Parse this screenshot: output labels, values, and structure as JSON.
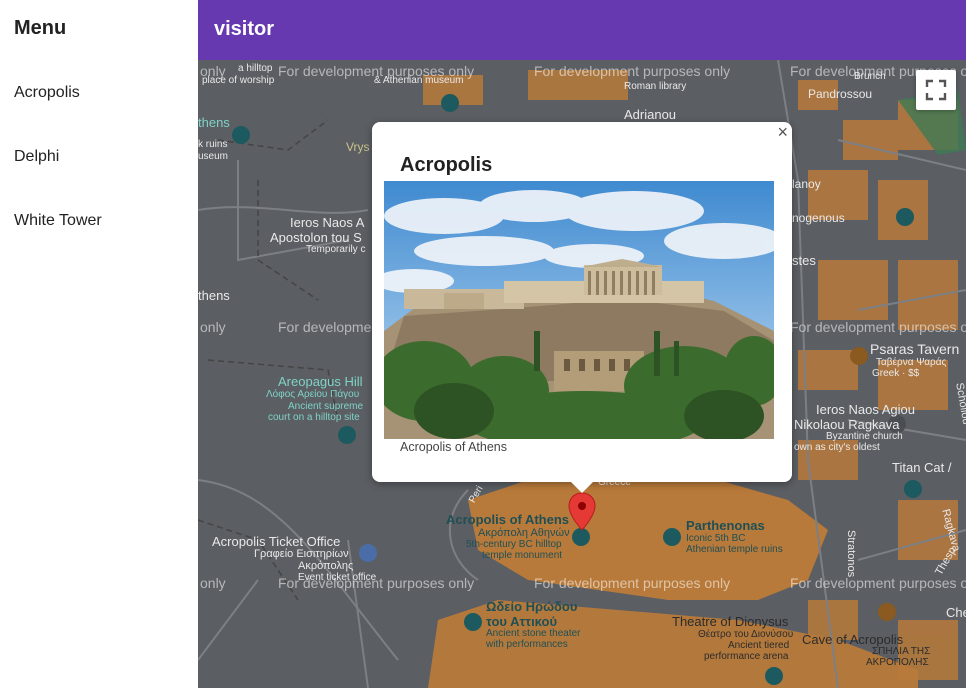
{
  "sidebar": {
    "title": "Menu",
    "items": [
      {
        "label": "Acropolis"
      },
      {
        "label": "Delphi"
      },
      {
        "label": "White Tower"
      }
    ]
  },
  "appbar": {
    "title": "visitor",
    "color": "#6639b0"
  },
  "map": {
    "watermark": "For development purposes only",
    "watermark_short": "only",
    "fullscreen_icon": "fullscreen-icon",
    "labels": {
      "adrianou": "Adrianou",
      "pandrossou": "Pandrossou",
      "roman_library": "Roman library",
      "hilltop_worship": "a hilltop",
      "place_worship": "place of worship",
      "athenian_museum": "& Athenian museum",
      "athens": "thens",
      "ruins": "k ruins",
      "museum": "useum",
      "vrys": "Vrys",
      "ieros_naos": "Ieros Naos A",
      "apostolon": "Apostolon tou S",
      "temp_closed": "Temporarily c",
      "athens2": "thens",
      "areopagus": "Areopagus Hill",
      "areopagus_gr": "Λόφος Αρείου Πάγου",
      "areopagus_desc1": "Ancient supreme",
      "areopagus_desc2": "court on a hilltop site",
      "ticket_office": "Acropolis Ticket Office",
      "ticket_gr1": "Γραφείο Εισιτηρίων",
      "ticket_gr2": "Ακρόπολης",
      "ticket_desc": "Event ticket office",
      "acropolis": "Acropolis of Athens",
      "acropolis_gr": "Ακρόπολη Αθηνών",
      "acropolis_desc1": "5th-century BC hilltop",
      "acropolis_desc2": "temple monument",
      "parthenonas": "Parthenonas",
      "parthenon_desc1": "Iconic 5th BC",
      "parthenon_desc2": "Athenian temple ruins",
      "odeio": "Ωδείο Ηρώδου",
      "odeio2": "του Αττικού",
      "odeio_desc1": "Ancient stone theater",
      "odeio_desc2": "with performances",
      "dionysus": "Theatre of Dionysus",
      "dionysus_gr": "Θέατρο του Διονύσου",
      "dionysus_desc1": "Ancient tiered",
      "dionysus_desc2": "performance arena",
      "cave": "Cave of Acropolis",
      "cave_gr1": "ΣΠΗΛΙΑ ΤΗΣ",
      "cave_gr2": "ΑΚΡΟΠΟΛΗΣ",
      "psaras": "Psaras Tavern",
      "psaras_gr": "Ταβέρνα Ψαράς",
      "psaras_desc": "Greek · $$",
      "ieros_naos2": "Ieros Naos Agiou",
      "nikolaou": "Nikolaou Ragkava",
      "byzantine1": "Byzantine church",
      "byzantine2": "own as city's oldest",
      "titan": "Titan Cat /",
      "lanoy": "lanoy",
      "nogenous": "nogenous",
      "stes": "stes",
      "brunch": "Brunch",
      "stratonos": "Stratonos",
      "ragkava": "Ragkava",
      "thespidos": "Thesp",
      "scholiou": "Scholiou",
      "che": "Che",
      "peri": "Peri",
      "greece": "Greece"
    }
  },
  "infowindow": {
    "title": "Acropolis",
    "caption": "Acropolis of Athens",
    "close_label": "×"
  },
  "colors": {
    "map_bg": "#5b5e63",
    "site_fill": "#b87a3a",
    "marker": "#e53935"
  }
}
